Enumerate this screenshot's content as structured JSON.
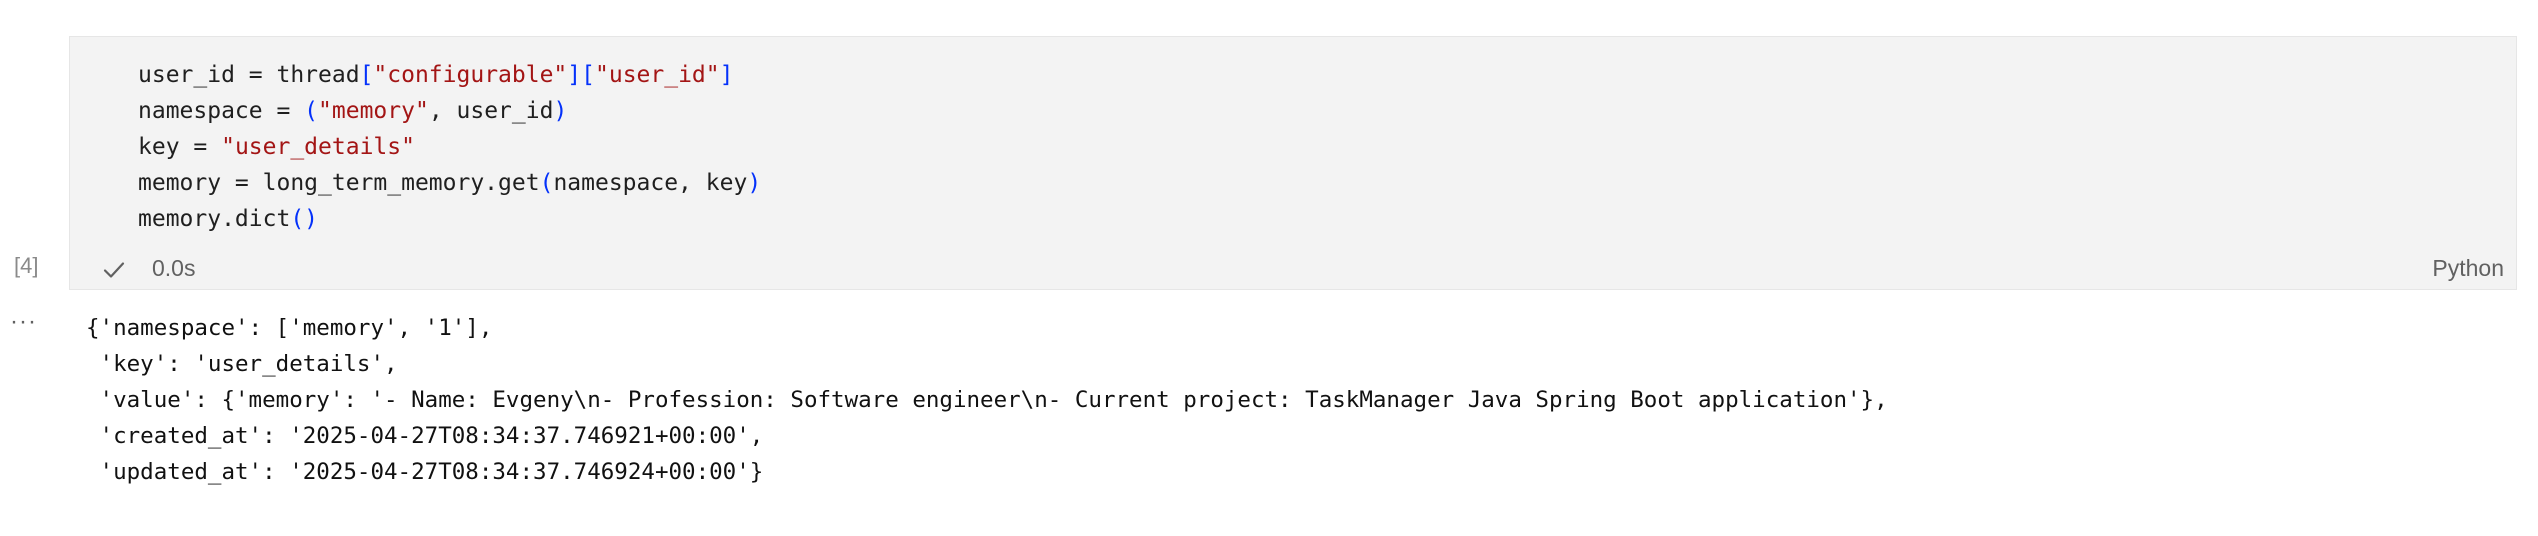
{
  "cell": {
    "execution_count": "[4]",
    "execution_time": "0.0s",
    "language": "Python",
    "output_menu": "···"
  },
  "code": {
    "lines": [
      {
        "parts": [
          {
            "t": "user_id = thread",
            "c": "plain"
          },
          {
            "t": "[",
            "c": "bracket"
          },
          {
            "t": "\"configurable\"",
            "c": "string"
          },
          {
            "t": "][",
            "c": "bracket"
          },
          {
            "t": "\"user_id\"",
            "c": "string"
          },
          {
            "t": "]",
            "c": "bracket"
          }
        ]
      },
      {
        "parts": [
          {
            "t": "namespace = ",
            "c": "plain"
          },
          {
            "t": "(",
            "c": "bracket"
          },
          {
            "t": "\"memory\"",
            "c": "string"
          },
          {
            "t": ", user_id",
            "c": "plain"
          },
          {
            "t": ")",
            "c": "bracket"
          }
        ]
      },
      {
        "parts": [
          {
            "t": "key = ",
            "c": "plain"
          },
          {
            "t": "\"user_details\"",
            "c": "string"
          }
        ]
      },
      {
        "parts": [
          {
            "t": "memory = long_term_memory.get",
            "c": "plain"
          },
          {
            "t": "(",
            "c": "bracket"
          },
          {
            "t": "namespace, key",
            "c": "plain"
          },
          {
            "t": ")",
            "c": "bracket"
          }
        ]
      },
      {
        "parts": [
          {
            "t": "memory.dict",
            "c": "plain"
          },
          {
            "t": "()",
            "c": "bracket"
          }
        ]
      }
    ]
  },
  "output": {
    "lines": [
      "{'namespace': ['memory', '1'],",
      " 'key': 'user_details',",
      " 'value': {'memory': '- Name: Evgeny\\n- Profession: Software engineer\\n- Current project: TaskManager Java Spring Boot application'},",
      " 'created_at': '2025-04-27T08:34:37.746921+00:00',",
      " 'updated_at': '2025-04-27T08:34:37.746924+00:00'}"
    ]
  },
  "colors": {
    "string": "#a31515",
    "bracket": "#0431fa",
    "plain": "#1f1f1f",
    "cell_background": "#f3f3f3",
    "muted": "#616161"
  },
  "icons": {
    "status": "check-icon"
  }
}
